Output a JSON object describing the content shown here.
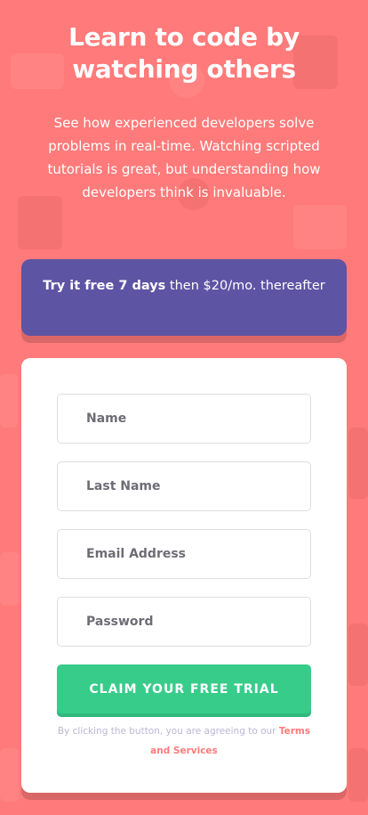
{
  "hero": {
    "title": "Learn to code by watching others",
    "description": "See how experienced developers solve problems in real-time. Watching scripted tutorials is great, but understanding how developers think is invaluable."
  },
  "promo": {
    "strong_text": "Try it free 7 days",
    "rest_text": " then $20/mo. thereafter"
  },
  "form": {
    "first_name_placeholder": "Name",
    "last_name_placeholder": "Last Name",
    "email_placeholder": "Email Address",
    "password_placeholder": "Password",
    "submit_label": "Claim your free trial",
    "terms_prefix": "By clicking the button, you are agreeing to our ",
    "terms_link": "Terms and Services"
  },
  "colors": {
    "background": "#ff7a7a",
    "promo": "#5e54a4",
    "cta": "#38cc8b",
    "text_dark": "#3d3b48",
    "muted": "#bab7d4"
  }
}
